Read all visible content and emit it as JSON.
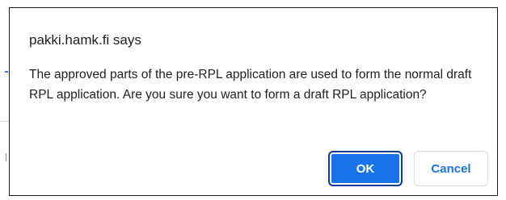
{
  "dialog": {
    "title": "pakki.hamk.fi says",
    "message": "The approved parts of the pre-RPL application are used to form the normal draft RPL application. Are you sure you want to form a draft RPL application?",
    "ok_label": "OK",
    "cancel_label": "Cancel"
  },
  "colors": {
    "accent": "#1a73e8",
    "text": "#202124",
    "focus_ring": "#0b3d91"
  }
}
